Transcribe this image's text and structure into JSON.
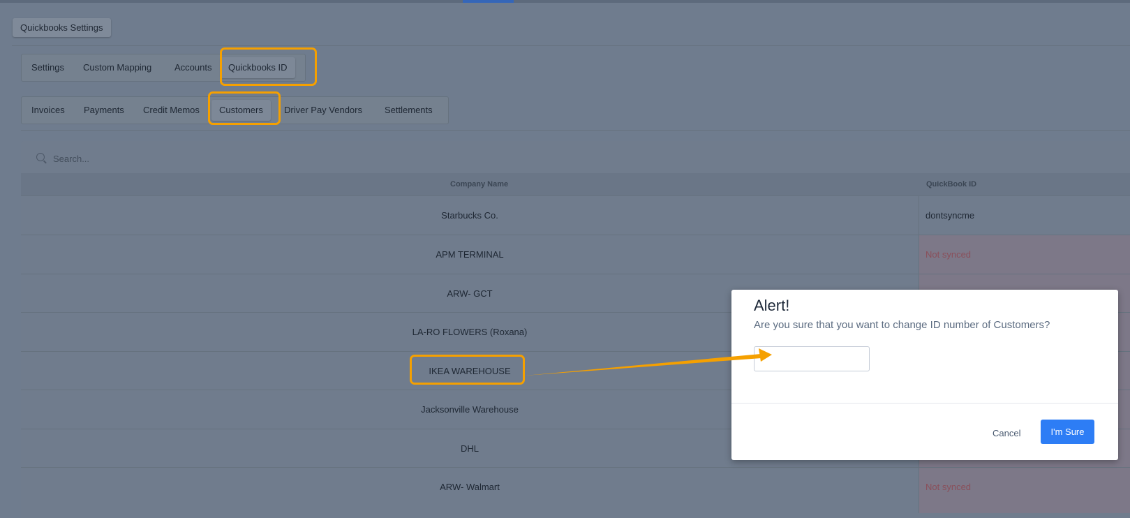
{
  "header": {
    "settings_title": "Quickbooks Settings"
  },
  "main_tabs": [
    {
      "label": "Settings"
    },
    {
      "label": "Custom Mapping"
    },
    {
      "label": "Accounts"
    },
    {
      "label": "Quickbooks ID",
      "active": true
    }
  ],
  "sub_tabs": [
    {
      "label": "Invoices"
    },
    {
      "label": "Payments"
    },
    {
      "label": "Credit Memos"
    },
    {
      "label": "Customers",
      "active": true
    },
    {
      "label": "Driver Pay Vendors"
    },
    {
      "label": "Settlements"
    }
  ],
  "search": {
    "placeholder": "Search..."
  },
  "table": {
    "columns": [
      "Company Name",
      "QuickBook ID"
    ],
    "rows": [
      {
        "company": "Starbucks Co.",
        "qb_id": "dontsyncme",
        "synced": true
      },
      {
        "company": "APM TERMINAL",
        "qb_id": "Not synced",
        "synced": false
      },
      {
        "company": "ARW- GCT",
        "qb_id": "",
        "synced": false
      },
      {
        "company": "LA-RO FLOWERS (Roxana)",
        "qb_id": "",
        "synced": false
      },
      {
        "company": "IKEA WAREHOUSE",
        "qb_id": "",
        "synced": false
      },
      {
        "company": "Jacksonville Warehouse",
        "qb_id": "",
        "synced": false
      },
      {
        "company": "DHL",
        "qb_id": "",
        "synced": false
      },
      {
        "company": "ARW- Walmart",
        "qb_id": "Not synced",
        "synced": false
      }
    ]
  },
  "modal": {
    "title": "Alert!",
    "message": "Are you sure that you want to change ID number of Customers?",
    "input_value": "",
    "cancel_label": "Cancel",
    "confirm_label": "I'm Sure"
  },
  "colors": {
    "highlight": "#f5a000",
    "primary_button": "#2d7df5",
    "not_synced_text": "#8a4f5a"
  }
}
